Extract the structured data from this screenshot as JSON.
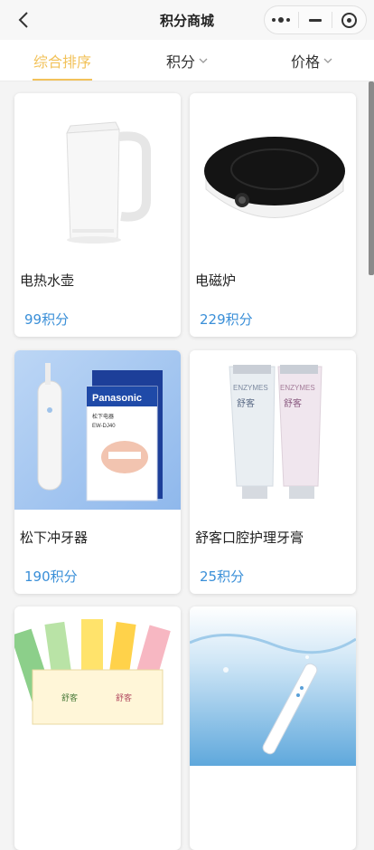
{
  "header": {
    "title": "积分商城",
    "back_icon": "chevron-left-icon",
    "more_icon": "more-dots-icon",
    "minimize_icon": "minus-icon",
    "close_icon": "target-circle-icon"
  },
  "tabs": [
    {
      "label": "综合排序",
      "active": true
    },
    {
      "label": "积分",
      "active": false,
      "icon": "chevron-down-icon"
    },
    {
      "label": "价格",
      "active": false,
      "icon": "chevron-down-icon"
    }
  ],
  "products": [
    {
      "name": "电热水壶",
      "price": "99积分",
      "icon": "kettle-image"
    },
    {
      "name": "电磁炉",
      "price": "229积分",
      "icon": "induction-cooker-image"
    },
    {
      "name": "松下冲牙器",
      "price": "190积分",
      "icon": "water-flosser-image"
    },
    {
      "name": "舒客口腔护理牙膏",
      "price": "25积分",
      "icon": "toothpaste-image"
    },
    {
      "name": "",
      "price": "",
      "icon": "toothbrush-pack-image"
    },
    {
      "name": "",
      "price": "",
      "icon": "electric-toothbrush-image"
    }
  ],
  "product_image_text": {
    "flosser_brand": "Panasonic",
    "flosser_sub": "松下电器",
    "flosser_model": "EW-DJ40",
    "toothpaste_brand": "ENZYMES",
    "toothpaste_cn": "舒客",
    "toothbrush_label": "舒客"
  },
  "colors": {
    "accent": "#f2c25a",
    "price": "#3a8fd8",
    "background": "#f4f4f4"
  }
}
